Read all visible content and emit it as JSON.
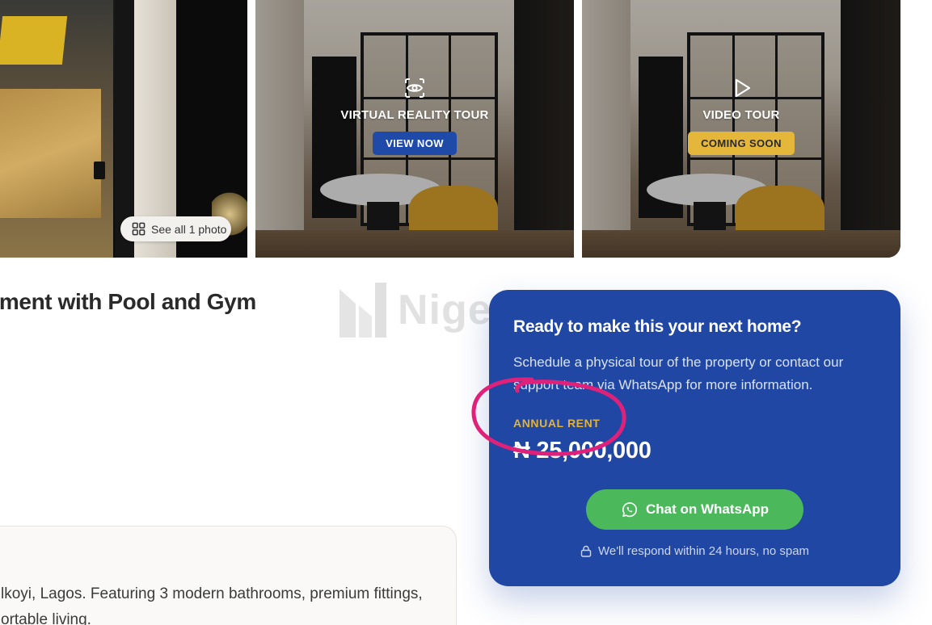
{
  "gallery": {
    "see_all_label": "See all 1 photo",
    "vr_tour": {
      "label": "VIRTUAL REALITY TOUR",
      "button": "VIEW NOW",
      "icon": "vr-eye-icon"
    },
    "video_tour": {
      "label": "VIDEO TOUR",
      "button": "COMING SOON",
      "icon": "play-icon"
    }
  },
  "property": {
    "title_fragment": "tment with Pool and Gym",
    "description_fragment_line1": "lkoyi, Lagos. Featuring 3 modern bathrooms, premium fittings,",
    "description_fragment_line2": "ortable living."
  },
  "watermark": {
    "text": "Nigerent"
  },
  "cta": {
    "title": "Ready to make this your next home?",
    "subtitle": "Schedule a physical tour of the property or contact our support team via WhatsApp for more information.",
    "rent_label": "ANNUAL RENT",
    "rent_value": "₦ 25,000,000",
    "whatsapp_button": "Chat on WhatsApp",
    "response_note": "We'll respond within 24 hours, no spam"
  },
  "colors": {
    "brand_blue": "#1f47a3",
    "accent_yellow": "#e4b73a",
    "whatsapp_green": "#4cb85c",
    "annotation_pink": "#e0217a"
  }
}
